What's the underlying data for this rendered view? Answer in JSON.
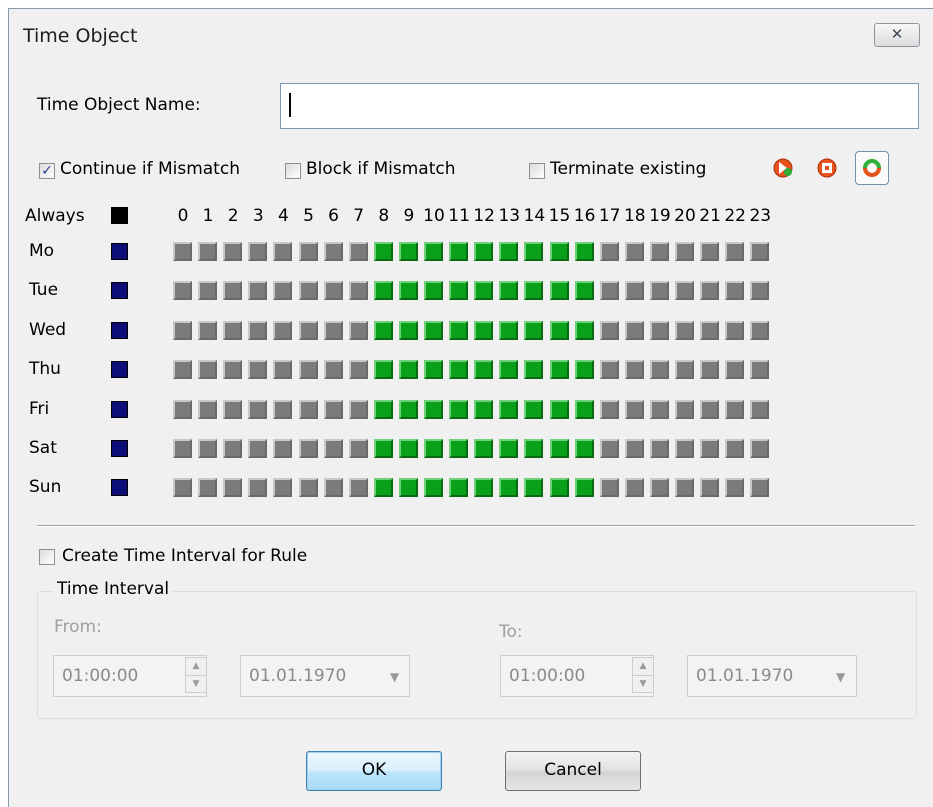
{
  "window": {
    "title": "Time Object",
    "close_icon": "✕"
  },
  "name_field": {
    "label": "Time Object Name:",
    "value": ""
  },
  "options": {
    "continue_if_mismatch": {
      "label": "Continue if Mismatch",
      "checked": true
    },
    "block_if_mismatch": {
      "label": "Block if Mismatch",
      "checked": false
    },
    "terminate_existing": {
      "label": "Terminate existing",
      "checked": false
    }
  },
  "toolbar_icons": [
    "continue-mode-icon",
    "block-mode-icon",
    "terminate-mode-icon"
  ],
  "grid": {
    "always_label": "Always",
    "hours": [
      "0",
      "1",
      "2",
      "3",
      "4",
      "5",
      "6",
      "7",
      "8",
      "9",
      "10",
      "11",
      "12",
      "13",
      "14",
      "15",
      "16",
      "17",
      "18",
      "19",
      "20",
      "21",
      "22",
      "23"
    ],
    "days": [
      "Mo",
      "Tue",
      "Wed",
      "Thu",
      "Fri",
      "Sat",
      "Sun"
    ],
    "active_hours": [
      8,
      9,
      10,
      11,
      12,
      13,
      14,
      15,
      16
    ],
    "colors": {
      "active": "#0aa01a",
      "inactive": "#7b7b7b",
      "day_selector": "#0d0d78",
      "always_selector": "#000000"
    }
  },
  "interval": {
    "create_label": "Create Time Interval for Rule",
    "create_checked": false,
    "group_label": "Time Interval",
    "from_label": "From:",
    "to_label": "To:",
    "from_time": "01:00:00",
    "from_date": "01.01.1970",
    "to_time": "01:00:00",
    "to_date": "01.01.1970"
  },
  "buttons": {
    "ok": "OK",
    "cancel": "Cancel"
  }
}
